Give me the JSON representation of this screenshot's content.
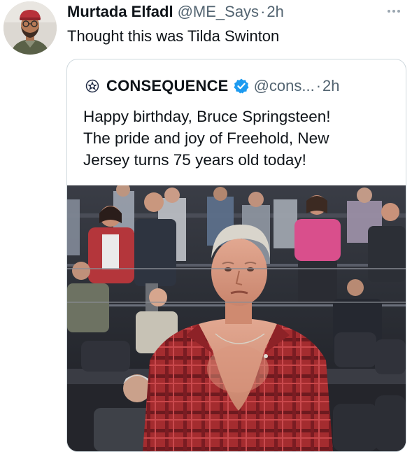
{
  "tweet": {
    "author_name": "Murtada Elfadl",
    "handle": "@ME_Says",
    "separator": "·",
    "time": "2h",
    "text": "Thought this was Tilda Swinton",
    "more_icon": "more-horizontal-icon"
  },
  "quote": {
    "author_name": "CONSEQUENCE",
    "verified": true,
    "verified_color": "#1d9bf0",
    "handle": "@cons...",
    "separator": "·",
    "time": "2h",
    "lines": [
      "Happy birthday, Bruce Springsteen!",
      "The pride and joy of Freehold, New",
      "Jersey turns 75 years old today!"
    ],
    "media_description_icon": "photo"
  },
  "colors": {
    "text_primary": "#0f1419",
    "text_secondary": "#536471",
    "border": "#cfd9de",
    "accent": "#1d9bf0"
  }
}
